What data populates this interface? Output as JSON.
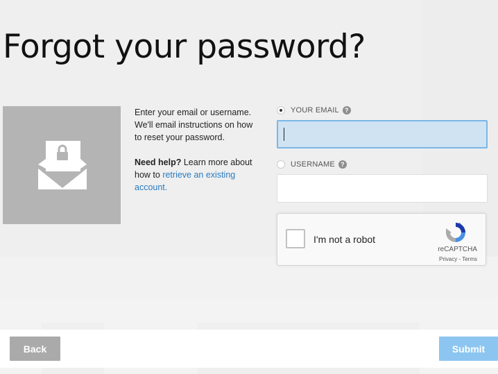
{
  "page": {
    "title": "Forgot your password?"
  },
  "info": {
    "instructions": "Enter your email or username. We'll email instructions on how to reset your password.",
    "help_bold": "Need help?",
    "help_text": " Learn more about how to ",
    "help_link": "retrieve an existing account."
  },
  "form": {
    "email_label": "YOUR EMAIL",
    "email_value": "",
    "username_label": "USERNAME",
    "username_value": "",
    "selected": "email"
  },
  "recaptcha": {
    "label": "I'm not a robot",
    "brand": "reCAPTCHA",
    "terms": "Privacy - Terms"
  },
  "buttons": {
    "back": "Back",
    "submit": "Submit"
  },
  "colors": {
    "link": "#2a7bbf",
    "submit_bg": "#8cc6f0",
    "back_bg": "#aaaaaa",
    "focused_input_bg": "#cfe3f3"
  },
  "icons": {
    "illustration": "envelope-lock-icon",
    "help": "question-circle-icon",
    "recaptcha": "recaptcha-logo-icon"
  }
}
